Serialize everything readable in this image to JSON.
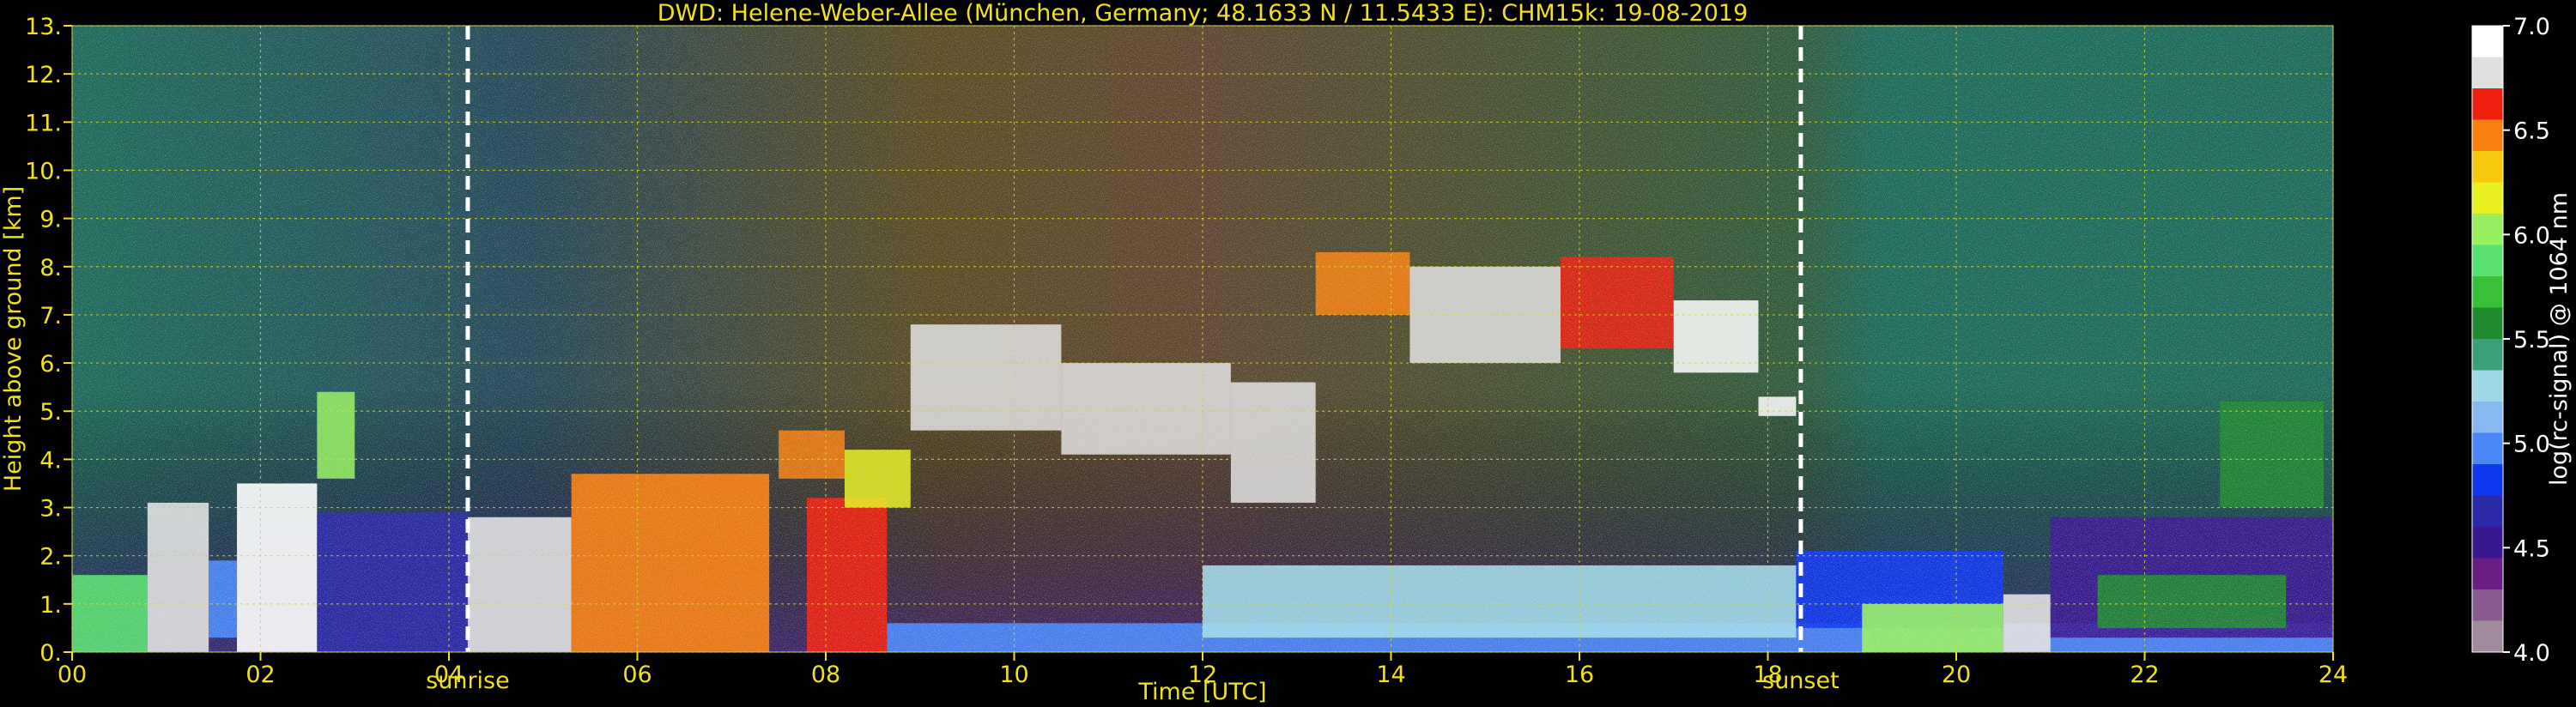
{
  "chart_data": {
    "type": "heatmap",
    "title": "DWD: Helene-Weber-Allee (München, Germany; 48.1633 N / 11.5433 E):    CHM15k: 19-08-2019",
    "xlabel": "Time [UTC]",
    "ylabel": "Height above ground [km]",
    "xlim": [
      0,
      24
    ],
    "ylim": [
      0,
      13
    ],
    "x_ticks": [
      "00",
      "02",
      "04",
      "06",
      "08",
      "10",
      "12",
      "14",
      "16",
      "18",
      "20",
      "22",
      "24"
    ],
    "x_tick_values": [
      0,
      2,
      4,
      6,
      8,
      10,
      12,
      14,
      16,
      18,
      20,
      22,
      24
    ],
    "y_ticks": [
      "0.",
      "1.",
      "2.",
      "3.",
      "4.",
      "5.",
      "6.",
      "7.",
      "8.",
      "9.",
      "10.",
      "11.",
      "12.",
      "13."
    ],
    "y_tick_values": [
      0,
      1,
      2,
      3,
      4,
      5,
      6,
      7,
      8,
      9,
      10,
      11,
      12,
      13
    ],
    "grid": true,
    "colorbar": {
      "label": "log(rc-signal) @ 1064 nm",
      "min": 4.0,
      "max": 7.0,
      "ticks": [
        "4.0",
        "4.5",
        "5.0",
        "5.5",
        "6.0",
        "6.5",
        "7.0"
      ],
      "tick_values": [
        4.0,
        4.5,
        5.0,
        5.5,
        6.0,
        6.5,
        7.0
      ],
      "colors": [
        "#a08aa0",
        "#8a5a90",
        "#6a1d82",
        "#3a1890",
        "#2a2aa8",
        "#1038f0",
        "#4a88f8",
        "#88b8f0",
        "#a0d8e8",
        "#3aa078",
        "#208a30",
        "#38c038",
        "#58e070",
        "#98f060",
        "#e8f020",
        "#f8c810",
        "#f88010",
        "#f02010",
        "#e0e0e0",
        "#ffffff"
      ]
    },
    "events": [
      {
        "label": "sunrise",
        "x": 4.2
      },
      {
        "label": "sunset",
        "x": 18.35
      }
    ],
    "signal_segments": [
      {
        "x_range": [
          0.0,
          0.8
        ],
        "base_km": 0.0,
        "top_km": 1.6,
        "value": 5.9
      },
      {
        "x_range": [
          0.8,
          1.45
        ],
        "base_km": 0.0,
        "top_km": 3.1,
        "value": 6.8
      },
      {
        "x_range": [
          1.45,
          1.75
        ],
        "base_km": 0.3,
        "top_km": 1.9,
        "value": 4.9
      },
      {
        "x_range": [
          1.75,
          2.6
        ],
        "base_km": 0.0,
        "top_km": 3.5,
        "value": 6.9
      },
      {
        "x_range": [
          2.6,
          4.2
        ],
        "base_km": 0.0,
        "top_km": 2.9,
        "value": 4.7
      },
      {
        "x_range": [
          4.2,
          5.3
        ],
        "base_km": 0.0,
        "top_km": 2.8,
        "value": 6.7
      },
      {
        "x_range": [
          5.3,
          7.4
        ],
        "base_km": 0.0,
        "top_km": 3.7,
        "value": 6.5
      },
      {
        "x_range": [
          7.8,
          8.65
        ],
        "base_km": 0.0,
        "top_km": 3.2,
        "value": 6.6
      },
      {
        "x_range": [
          8.65,
          24.0
        ],
        "base_km": 0.0,
        "top_km": 0.6,
        "value": 5.0
      },
      {
        "x_range": [
          12.0,
          18.3
        ],
        "base_km": 0.3,
        "top_km": 1.8,
        "value": 5.3
      },
      {
        "x_range": [
          18.3,
          20.5
        ],
        "base_km": 0.5,
        "top_km": 2.1,
        "value": 4.8
      },
      {
        "x_range": [
          19.0,
          20.5
        ],
        "base_km": 0.0,
        "top_km": 1.0,
        "value": 6.0
      },
      {
        "x_range": [
          20.5,
          21.0
        ],
        "base_km": 0.0,
        "top_km": 1.2,
        "value": 6.8
      },
      {
        "x_range": [
          21.0,
          24.0
        ],
        "base_km": 0.3,
        "top_km": 2.8,
        "value": 4.6
      },
      {
        "x_range": [
          21.5,
          23.5
        ],
        "base_km": 0.5,
        "top_km": 1.6,
        "value": 5.6
      }
    ],
    "cloud_layers": [
      {
        "x_range": [
          8.9,
          10.5
        ],
        "base_km": 4.6,
        "top_km": 6.8,
        "value": 6.8
      },
      {
        "x_range": [
          10.5,
          12.3
        ],
        "base_km": 4.1,
        "top_km": 6.0,
        "value": 6.8
      },
      {
        "x_range": [
          12.3,
          13.2
        ],
        "base_km": 3.1,
        "top_km": 5.6,
        "value": 6.7
      },
      {
        "x_range": [
          13.2,
          14.2
        ],
        "base_km": 7.0,
        "top_km": 8.3,
        "value": 6.5
      },
      {
        "x_range": [
          14.2,
          15.8
        ],
        "base_km": 6.0,
        "top_km": 8.0,
        "value": 6.7
      },
      {
        "x_range": [
          15.8,
          17.0
        ],
        "base_km": 6.3,
        "top_km": 8.2,
        "value": 6.6
      },
      {
        "x_range": [
          17.0,
          17.9
        ],
        "base_km": 5.8,
        "top_km": 7.3,
        "value": 6.9
      },
      {
        "x_range": [
          17.9,
          18.3
        ],
        "base_km": 4.9,
        "top_km": 5.3,
        "value": 6.9
      },
      {
        "x_range": [
          2.6,
          3.0
        ],
        "base_km": 3.6,
        "top_km": 5.4,
        "value": 6.0
      },
      {
        "x_range": [
          7.5,
          8.2
        ],
        "base_km": 3.6,
        "top_km": 4.6,
        "value": 6.5
      },
      {
        "x_range": [
          8.2,
          8.9
        ],
        "base_km": 3.0,
        "top_km": 4.2,
        "value": 6.2
      },
      {
        "x_range": [
          22.8,
          23.9
        ],
        "base_km": 3.0,
        "top_km": 5.2,
        "value": 5.6
      }
    ]
  }
}
